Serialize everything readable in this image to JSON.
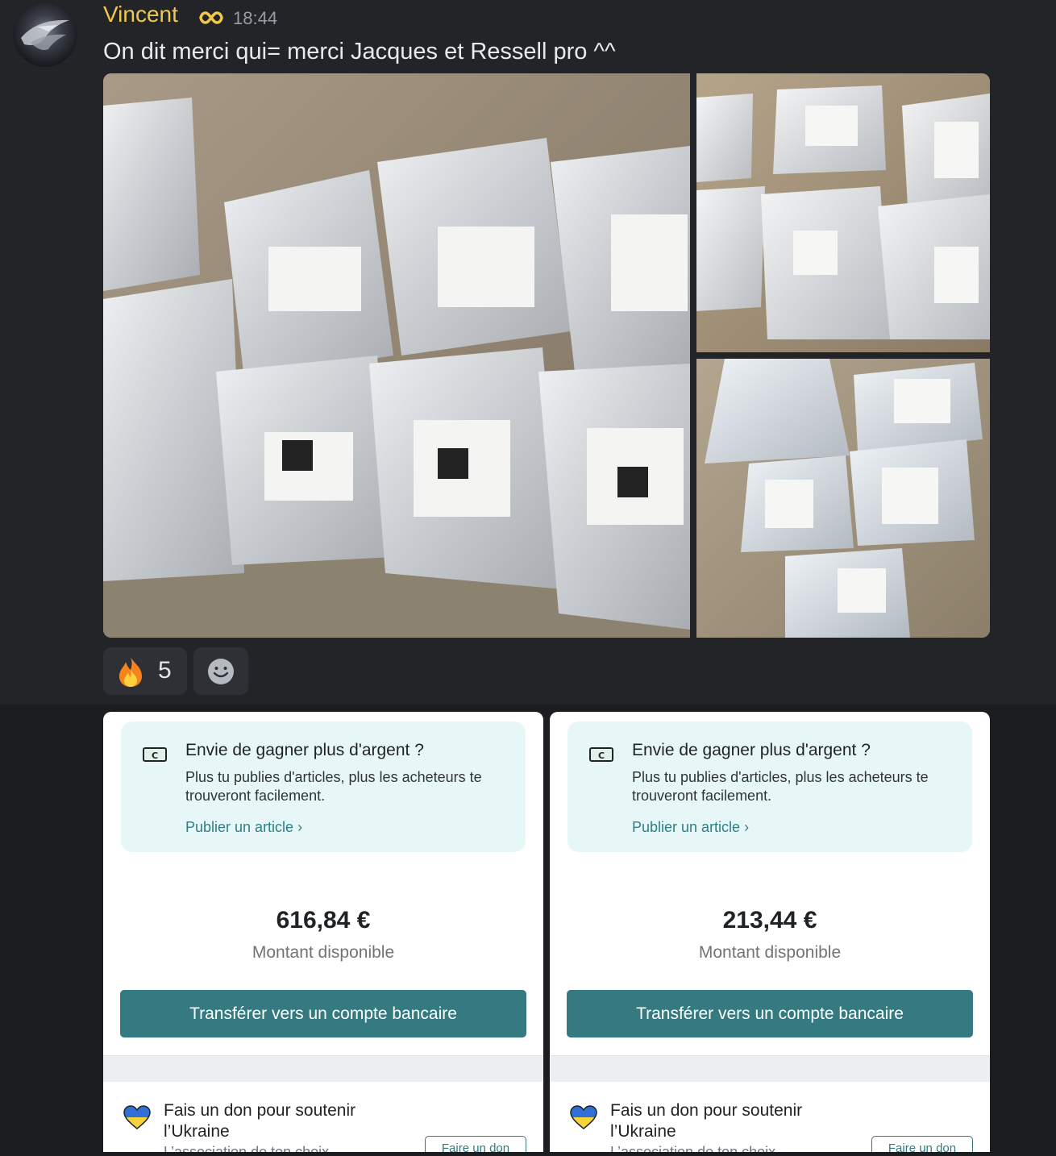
{
  "message": {
    "author": "Vincent",
    "timestamp": "18:44",
    "text": "On dit merci qui= merci Jacques et Ressell pro ^^",
    "author_color": "#f0c94a",
    "badge_icon": "infinity-icon",
    "attachments": [
      "photo-parcels-large",
      "photo-parcels-top-right",
      "photo-parcels-bottom-right"
    ]
  },
  "reactions": [
    {
      "emoji": "fire-emoji",
      "count": "5"
    }
  ],
  "add_reaction_icon": "smiley-icon",
  "cards": [
    {
      "promo_title": "Envie de gagner plus d'argent ?",
      "promo_body": "Plus tu publies d'articles, plus les acheteurs te trouveront facilement.",
      "promo_link": "Publier un article",
      "amount": "616,84 €",
      "amount_label": "Montant disponible",
      "transfer_label": "Transférer vers un compte bancaire",
      "donation_title": "Fais un don pour soutenir l’Ukraine",
      "donation_sub": "L’association de ton choix",
      "donation_button": "Faire un don"
    },
    {
      "promo_title": "Envie de gagner plus d'argent ?",
      "promo_body": "Plus tu publies d'articles, plus les acheteurs te trouveront facilement.",
      "promo_link": "Publier un article",
      "amount": "213,44 €",
      "amount_label": "Montant disponible",
      "transfer_label": "Transférer vers un compte bancaire",
      "donation_title": "Fais un don pour soutenir l’Ukraine",
      "donation_sub": "L’association de ton choix",
      "donation_button": "Faire un don"
    }
  ],
  "colors": {
    "accent": "#347a80",
    "promo_bg": "#e7f7f7",
    "chat_bg": "#232428"
  }
}
